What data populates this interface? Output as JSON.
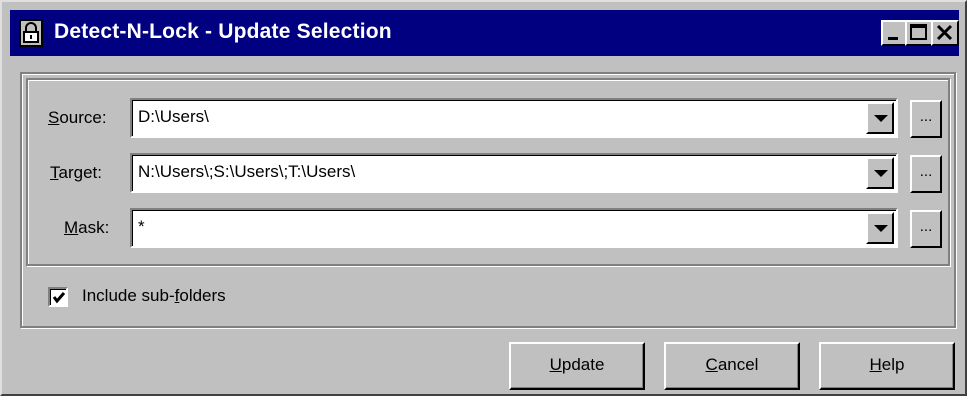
{
  "window": {
    "title": "Detect-N-Lock - Update Selection",
    "controls": {
      "minimize": "minimize",
      "maximize": "maximize",
      "close": "close"
    }
  },
  "fields": {
    "source": {
      "label_accel": "S",
      "label_rest": "ource:",
      "value": "D:\\Users\\"
    },
    "target": {
      "label_accel": "T",
      "label_rest": "arget:",
      "value": "N:\\Users\\;S:\\Users\\;T:\\Users\\"
    },
    "mask": {
      "label_accel": "M",
      "label_rest": "ask:",
      "value": "*"
    },
    "browse_label": "..."
  },
  "options": {
    "include_subfolders": {
      "label_pre": "Include sub-",
      "label_accel": "f",
      "label_post": "olders",
      "checked": true
    }
  },
  "buttons": {
    "update": {
      "accel": "U",
      "rest": "pdate"
    },
    "cancel": {
      "accel": "C",
      "rest": "ancel"
    },
    "help": {
      "accel": "H",
      "rest": "elp"
    }
  },
  "colors": {
    "titlebar": "#000080",
    "face": "#c0c0c0",
    "field": "#ffffff"
  },
  "icons": [
    "lock-icon",
    "minimize-icon",
    "maximize-icon",
    "close-icon",
    "dropdown-arrow-icon",
    "checkmark-icon"
  ]
}
